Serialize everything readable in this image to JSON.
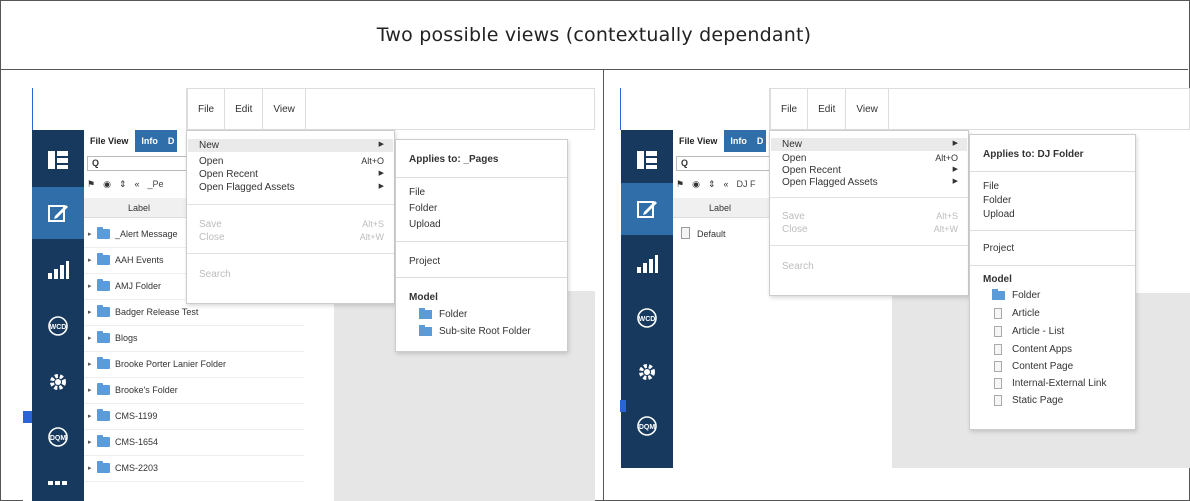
{
  "heading": "Two possible views (contextually dependant)",
  "colors": {
    "rail": "#17395e",
    "rail_active": "#2f6ea8",
    "folder": "#5a9bd8",
    "tab_active": "#2f6ea8"
  },
  "left": {
    "menubar": [
      "File",
      "Edit",
      "View"
    ],
    "panel": {
      "tabs": [
        "File View",
        "Info",
        "D"
      ],
      "search_icon": "Q",
      "breadcrumb": "_Pe",
      "column_label": "Label",
      "rows": [
        "_Alert Message",
        "AAH Events",
        "AMJ Folder",
        "Badger Release Test",
        "Blogs",
        "Brooke Porter Lanier Folder",
        "Brooke's Folder",
        "CMS-1199",
        "CMS-1654",
        "CMS-2203"
      ]
    },
    "file_menu": {
      "new": "New",
      "open": "Open",
      "open_shortcut": "Alt+O",
      "open_recent": "Open Recent",
      "open_flagged": "Open Flagged Assets",
      "save": "Save",
      "save_shortcut": "Alt+S",
      "close": "Close",
      "close_shortcut": "Alt+W",
      "search": "Search"
    },
    "submenu": {
      "applies_to": "Applies to: _Pages",
      "items": [
        "File",
        "Folder",
        "Upload"
      ],
      "project": "Project",
      "model_title": "Model",
      "model_items": [
        "Folder",
        "Sub-site Root Folder"
      ]
    }
  },
  "right": {
    "menubar": [
      "File",
      "Edit",
      "View"
    ],
    "panel": {
      "tabs": [
        "File View",
        "Info",
        "D"
      ],
      "search_icon": "Q",
      "breadcrumb": "DJ F",
      "column_label": "Label",
      "rows": [
        "Default"
      ]
    },
    "file_menu": {
      "new": "New",
      "open": "Open",
      "open_shortcut": "Alt+O",
      "open_recent": "Open Recent",
      "open_flagged": "Open Flagged Assets",
      "save": "Save",
      "save_shortcut": "Alt+S",
      "close": "Close",
      "close_shortcut": "Alt+W",
      "search": "Search"
    },
    "submenu": {
      "applies_to": "Applies to: DJ Folder",
      "items": [
        "File",
        "Folder",
        "Upload"
      ],
      "project": "Project",
      "model_title": "Model",
      "model_items": [
        "Folder",
        "Article",
        "Article - List",
        "Content Apps",
        "Content Page",
        "Internal-External Link",
        "Static Page"
      ]
    }
  },
  "icons": {
    "rail": [
      "dashboard-icon",
      "edit-icon",
      "reports-icon",
      "wcd-icon",
      "settings-icon",
      "dqm-icon"
    ],
    "toolbar": [
      "flag-icon",
      "globe-icon",
      "filter-icon",
      "back-icon"
    ]
  }
}
